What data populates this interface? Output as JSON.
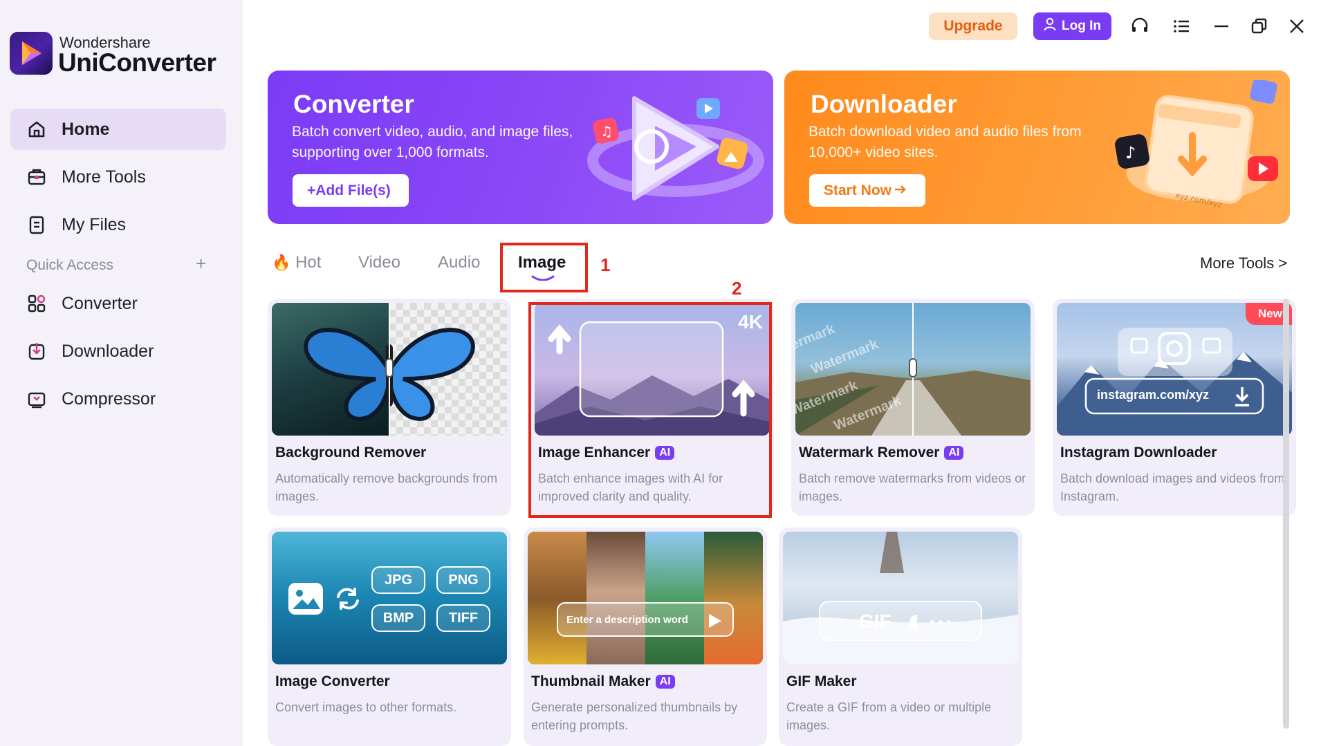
{
  "app": {
    "brand_small": "Wondershare",
    "brand_name": "UniConverter"
  },
  "sidebar": {
    "items": [
      {
        "label": "Home",
        "icon": "home-icon",
        "active": true
      },
      {
        "label": "More Tools",
        "icon": "toolbox-icon"
      },
      {
        "label": "My Files",
        "icon": "file-icon"
      }
    ],
    "quick_access_label": "Quick Access",
    "quick_access_add": "+",
    "quick_items": [
      {
        "label": "Converter",
        "icon": "converter-icon"
      },
      {
        "label": "Downloader",
        "icon": "downloader-icon"
      },
      {
        "label": "Compressor",
        "icon": "compressor-icon"
      }
    ]
  },
  "topbar": {
    "upgrade_label": "Upgrade",
    "login_label": "Log In",
    "icons": [
      "headset-icon",
      "menu-list-icon",
      "minimize-icon",
      "restore-icon",
      "close-icon"
    ]
  },
  "banners": {
    "converter": {
      "title": "Converter",
      "description": "Batch convert video, audio, and image files, supporting over 1,000 formats.",
      "button": "+Add File(s)"
    },
    "downloader": {
      "title": "Downloader",
      "description": "Batch download video and audio files from 10,000+ video sites.",
      "button": "Start Now",
      "illustration_text": "xyz.com/xyz"
    }
  },
  "tabs": {
    "items": [
      {
        "label": "Hot",
        "icon": "fire-icon"
      },
      {
        "label": "Video"
      },
      {
        "label": "Audio"
      },
      {
        "label": "Image",
        "active": true
      }
    ],
    "more_tools": "More Tools >"
  },
  "annotations": [
    "1",
    "2"
  ],
  "cards": [
    {
      "title": "Background Remover",
      "ai": false,
      "desc": "Automatically remove backgrounds from images."
    },
    {
      "title": "Image Enhancer",
      "ai": true,
      "desc": "Batch enhance images with AI for improved clarity and quality.",
      "thumb_label": "4K"
    },
    {
      "title": "Watermark Remover",
      "ai": true,
      "desc": "Batch remove watermarks from videos or images.",
      "thumb_watermark": "Watermark"
    },
    {
      "title": "Instagram Downloader",
      "ai": false,
      "desc": "Batch download images and videos from Instagram.",
      "badge": "New",
      "thumb_url": "instagram.com/xyz"
    },
    {
      "title": "Image Converter",
      "ai": false,
      "desc": "Convert images to other formats.",
      "formats": [
        "JPG",
        "PNG",
        "BMP",
        "TIFF"
      ]
    },
    {
      "title": "Thumbnail Maker",
      "ai": true,
      "desc": "Generate personalized thumbnails by entering prompts.",
      "thumb_prompt": "Enter a description word"
    },
    {
      "title": "GIF Maker",
      "ai": false,
      "desc": "Create a GIF from a video or multiple images.",
      "thumb_label": "GIF"
    }
  ],
  "ai_badge": "AI",
  "colors": {
    "accent": "#7a3cf3",
    "upgrade_bg": "#fde0c2",
    "upgrade_text": "#e85a10",
    "annotation_red": "#e2271c",
    "downloader_orange": "#ff9a33"
  }
}
